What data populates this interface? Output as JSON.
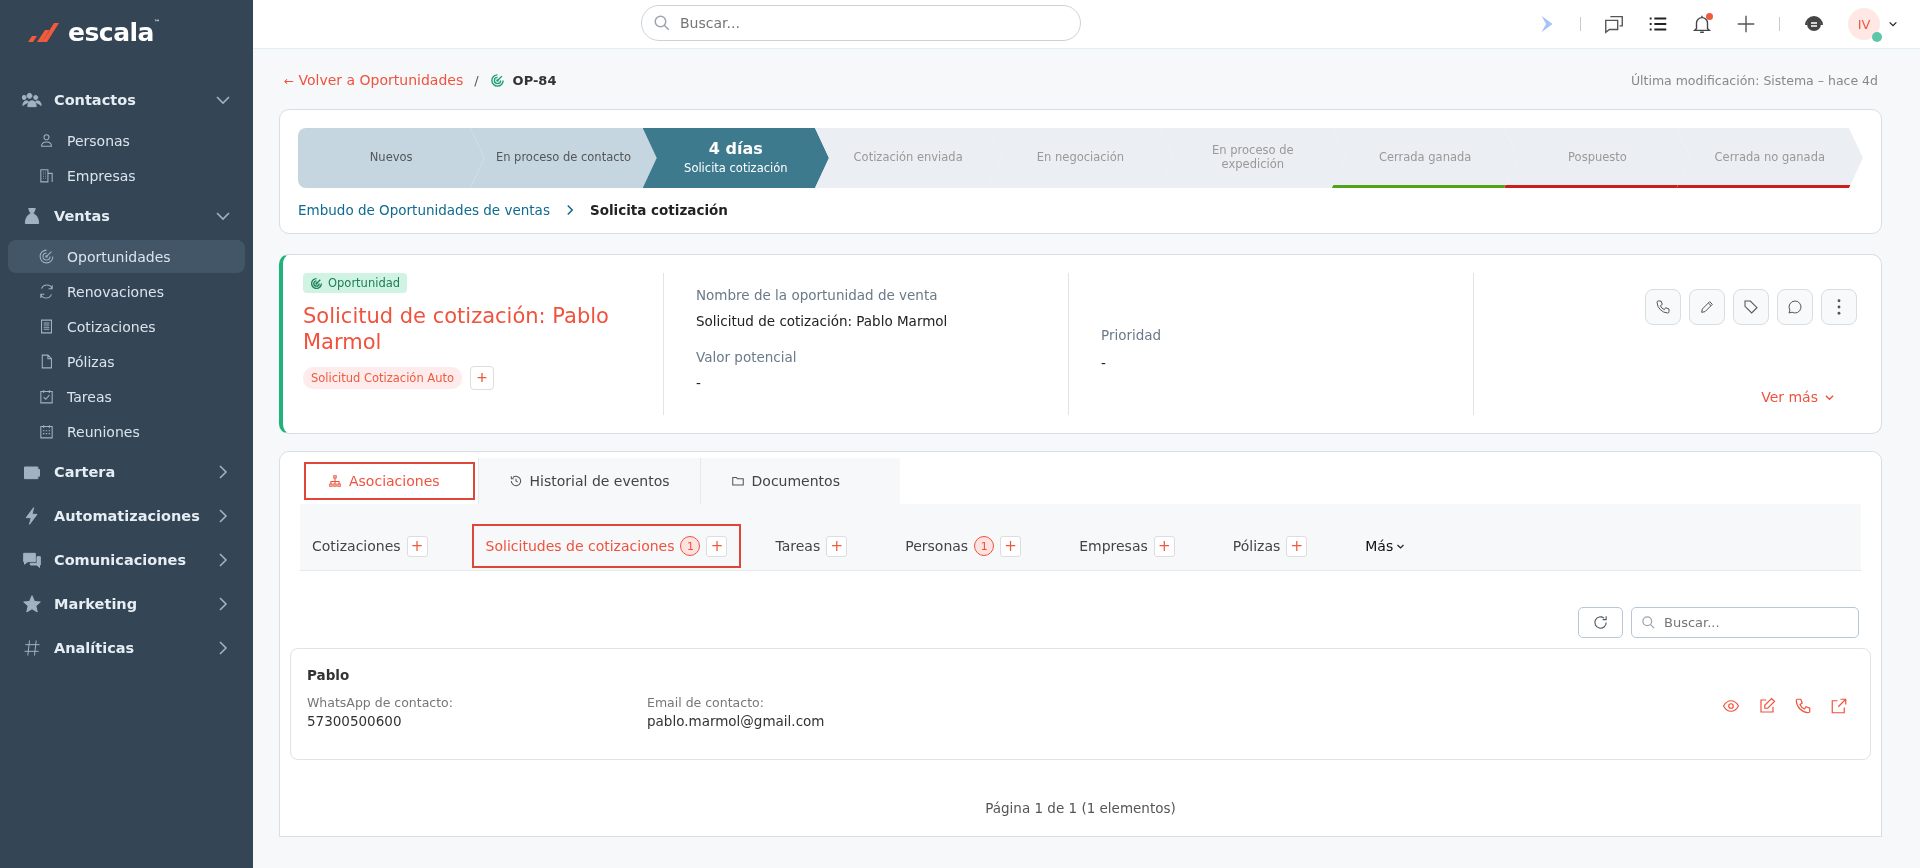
{
  "brand": {
    "name": "escala",
    "tm": "™"
  },
  "sidebar": {
    "sections": [
      {
        "label": "Contactos",
        "kind": "people",
        "expanded": true,
        "children": [
          {
            "label": "Personas",
            "kind": "person",
            "selected": false
          },
          {
            "label": "Empresas",
            "kind": "building",
            "selected": false
          }
        ]
      },
      {
        "label": "Ventas",
        "kind": "money",
        "expanded": true,
        "children": [
          {
            "label": "Oportunidades",
            "kind": "target",
            "selected": true
          },
          {
            "label": "Renovaciones",
            "kind": "refresh",
            "selected": false
          },
          {
            "label": "Cotizaciones",
            "kind": "doclines",
            "selected": false
          },
          {
            "label": "Pólizas",
            "kind": "doc",
            "selected": false
          },
          {
            "label": "Tareas",
            "kind": "calcheck",
            "selected": false
          },
          {
            "label": "Reuniones",
            "kind": "calendar",
            "selected": false
          }
        ]
      },
      {
        "label": "Cartera",
        "kind": "wallet",
        "expanded": false
      },
      {
        "label": "Automatizaciones",
        "kind": "bolt",
        "expanded": false
      },
      {
        "label": "Comunicaciones",
        "kind": "chat",
        "expanded": false
      },
      {
        "label": "Marketing",
        "kind": "star",
        "expanded": false
      },
      {
        "label": "Analíticas",
        "kind": "hash",
        "expanded": false
      }
    ]
  },
  "topbar": {
    "search_placeholder": "Buscar...",
    "avatar_initials": "IV",
    "notification_dot": true
  },
  "breadcrumb": {
    "back_arrow": "←",
    "back": "Volver a Oportunidades",
    "separator": "/",
    "current": "OP-84",
    "modified": "Última modificación: Sistema – hace 4d"
  },
  "pipeline": {
    "stages": [
      {
        "label": "Nuevos",
        "completed": true,
        "selected": false
      },
      {
        "label": "En proceso de contacto",
        "completed": true,
        "selected": false
      },
      {
        "label": "Solicita cotización",
        "days": "4 días",
        "completed": false,
        "selected": true
      },
      {
        "label": "Cotización enviada",
        "completed": false,
        "selected": false
      },
      {
        "label": "En negociación",
        "completed": false,
        "selected": false
      },
      {
        "label": "En proceso de expedición",
        "completed": false,
        "selected": false
      },
      {
        "label": "Cerrada ganada",
        "completed": false,
        "selected": false,
        "color": "#52a31a"
      },
      {
        "label": "Pospuesto",
        "completed": false,
        "selected": false,
        "color": "#cc1f1a"
      },
      {
        "label": "Cerrada no ganada",
        "completed": false,
        "selected": false,
        "color": "#cc1f1a"
      }
    ],
    "funnel": "Embudo de Oportunidades de ventas",
    "funnel_current": "Solicita cotización"
  },
  "opportunity": {
    "badge": "Oportunidad",
    "title": "Solicitud de cotización: Pablo Marmol",
    "tag": "Solicitud Cotización Auto",
    "tag_add": "+",
    "fields": [
      {
        "label": "Nombre de la oportunidad de venta",
        "value": "Solicitud de cotización: Pablo Marmol"
      },
      {
        "label": "Valor potencial",
        "value": "-"
      }
    ],
    "priority": {
      "label": "Prioridad",
      "value": "-"
    },
    "more": "Ver más"
  },
  "tabs": [
    {
      "label": "Asociaciones",
      "kind": "tree",
      "selected": true
    },
    {
      "label": "Historial de eventos",
      "kind": "history",
      "selected": false
    },
    {
      "label": "Documentos",
      "kind": "folder",
      "selected": false
    }
  ],
  "subtabs": [
    {
      "label": "Cotizaciones",
      "add": "+",
      "selected": false
    },
    {
      "label": "Solicitudes de cotizaciones",
      "count": "1",
      "add": "+",
      "selected": true
    },
    {
      "label": "Tareas",
      "add": "+",
      "selected": false
    },
    {
      "label": "Personas",
      "count": "1",
      "add": "+",
      "selected": false
    },
    {
      "label": "Empresas",
      "add": "+",
      "selected": false
    },
    {
      "label": "Pólizas",
      "add": "+",
      "selected": false
    }
  ],
  "more_tab": "Más",
  "list": {
    "search_placeholder": "Buscar...",
    "records": [
      {
        "name": "Pablo",
        "fields": [
          {
            "label": "WhatsApp de contacto:",
            "value": "57300500600"
          },
          {
            "label": "Email de contacto:",
            "value": "pablo.marmol@gmail.com"
          }
        ]
      }
    ],
    "pagination": "Página 1 de 1 (1 elementos)"
  }
}
